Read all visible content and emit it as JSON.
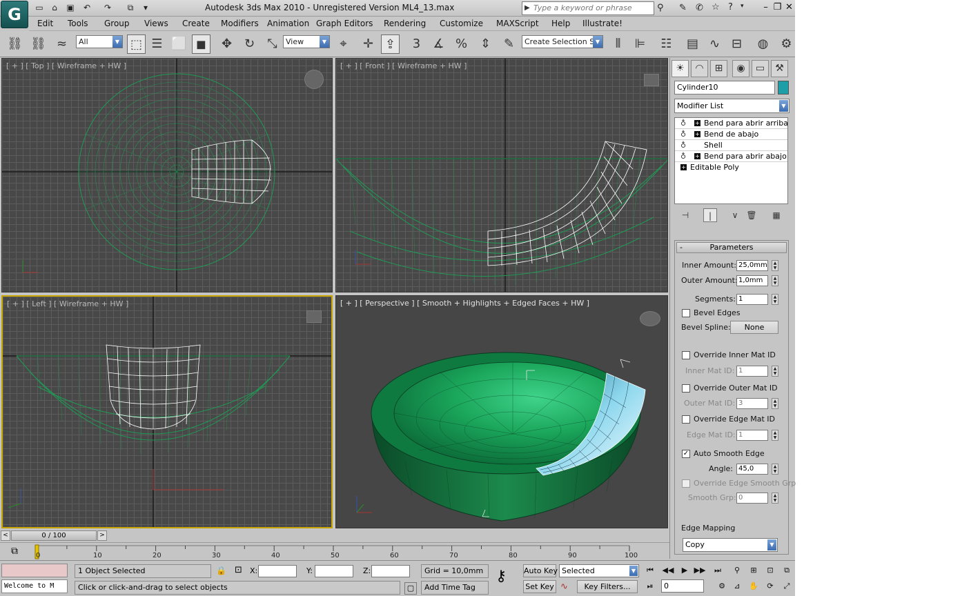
{
  "app": {
    "title": "Autodesk 3ds Max  2010   - Unregistered Version    ML4_13.max",
    "logo": "G",
    "search_placeholder": "Type a keyword or phrase"
  },
  "menu": [
    "Edit",
    "Tools",
    "Group",
    "Views",
    "Create",
    "Modifiers",
    "Animation",
    "Graph Editors",
    "Rendering",
    "Customize",
    "MAXScript",
    "Help",
    "Illustrate!"
  ],
  "toolbar": {
    "filter_value": "All",
    "refcoord_value": "View",
    "selection_set_placeholder": "Create Selection Se",
    "snap_label": "3"
  },
  "viewports": {
    "top": "[ + ] [ Top ] [ Wireframe + HW ]",
    "front": "[ + ] [ Front ] [ Wireframe + HW ]",
    "left": "[ + ] [ Left ] [ Wireframe + HW ]",
    "perspective": "[ + ] [ Perspective ] [ Smooth + Highlights + Edged Faces + HW ]"
  },
  "command_panel": {
    "object_name": "Cylinder10",
    "object_color": "#1e9fa8",
    "modifier_list": "Modifier List",
    "stack": [
      "Bend para abrir arriba",
      "Bend de abajo",
      "Shell",
      "Bend para abrir abajo",
      "Editable Poly"
    ],
    "rollout_title": "Parameters",
    "inner_amount_label": "Inner Amount:",
    "inner_amount": "25,0mm",
    "outer_amount_label": "Outer Amount:",
    "outer_amount": "1,0mm",
    "segments_label": "Segments:",
    "segments": "1",
    "bevel_edges": "Bevel Edges",
    "bevel_spline_label": "Bevel Spline:",
    "bevel_spline_value": "None",
    "override_inner": "Override Inner Mat ID",
    "inner_mat_label": "Inner Mat ID:",
    "inner_mat": "1",
    "override_outer": "Override Outer Mat ID",
    "outer_mat_label": "Outer Mat ID:",
    "outer_mat": "3",
    "override_edge": "Override Edge Mat ID",
    "edge_mat_label": "Edge Mat ID:",
    "edge_mat": "1",
    "auto_smooth": "Auto Smooth Edge",
    "angle_label": "Angle:",
    "angle": "45,0",
    "override_smooth": "Override Edge Smooth Grp",
    "smooth_grp_label": "Smooth Grp:",
    "smooth_grp": "0",
    "edge_mapping_label": "Edge Mapping",
    "edge_mapping_value": "Copy"
  },
  "timeline": {
    "frame_display": "0 / 100",
    "ticks": [
      "0",
      "10",
      "20",
      "30",
      "40",
      "50",
      "60",
      "70",
      "80",
      "90",
      "100"
    ]
  },
  "status": {
    "listener": "Welcome to M",
    "selected_count": "1 Object Selected",
    "prompt": "Click or click-and-drag to select objects",
    "x_label": "X:",
    "y_label": "Y:",
    "z_label": "Z:",
    "grid": "Grid = 10,0mm",
    "add_time_tag": "Add Time Tag",
    "auto_key": "Auto Key",
    "set_key": "Set Key",
    "selected_value": "Selected",
    "key_filters": "Key Filters...",
    "current_frame": "0"
  },
  "colors": {
    "accent_blue": "#3c6cb0",
    "bowl_green": "#1a8f4e",
    "wire_green": "#1f9a55",
    "selected_wire": "#ffffff"
  }
}
